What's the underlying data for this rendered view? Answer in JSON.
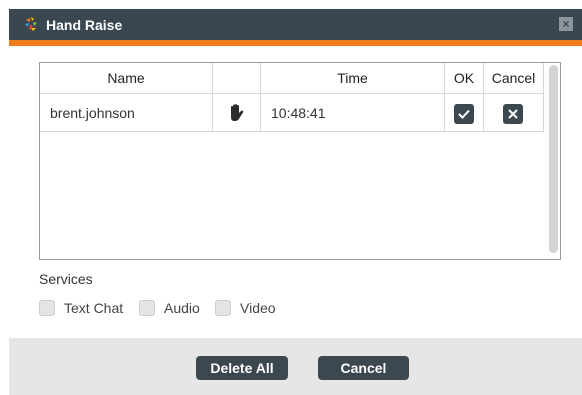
{
  "window": {
    "title": "Hand Raise",
    "close_glyph": "×",
    "icon": "hand-raise-logo-icon"
  },
  "table": {
    "columns": {
      "name": "Name",
      "icon": "",
      "time": "Time",
      "ok": "OK",
      "cancel": "Cancel"
    },
    "rows": [
      {
        "name": "brent.johnson",
        "status_icon": "raised-hand-icon",
        "time": "10:48:41",
        "ok_icon": "checkmark-icon",
        "cancel_icon": "close-icon"
      }
    ]
  },
  "services": {
    "label": "Services",
    "options": [
      {
        "label": "Text Chat",
        "checked": false
      },
      {
        "label": "Audio",
        "checked": false
      },
      {
        "label": "Video",
        "checked": false
      }
    ]
  },
  "footer": {
    "delete_all_label": "Delete All",
    "cancel_label": "Cancel"
  },
  "colors": {
    "titlebar": "#3b4750",
    "accent": "#f07c1e",
    "button": "#3c4850",
    "footer": "#e6e6e6"
  }
}
